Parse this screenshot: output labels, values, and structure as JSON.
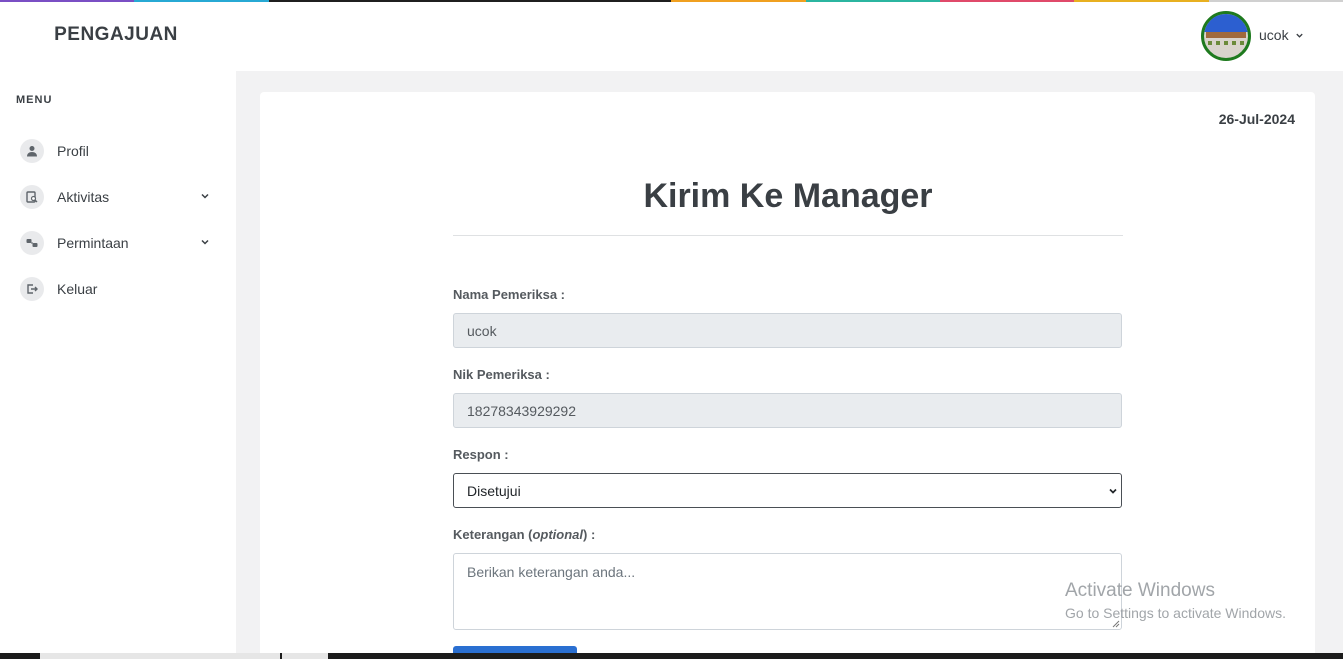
{
  "app": {
    "brand": "PENGAJUAN"
  },
  "sidebar": {
    "menu_label": "MENU",
    "items": [
      {
        "label": "Profil",
        "icon": "user-icon",
        "has_submenu": false
      },
      {
        "label": "Aktivitas",
        "icon": "activity-search-icon",
        "has_submenu": true
      },
      {
        "label": "Permintaan",
        "icon": "request-icon",
        "has_submenu": true
      },
      {
        "label": "Keluar",
        "icon": "logout-icon",
        "has_submenu": false
      }
    ]
  },
  "header": {
    "username": "ucok"
  },
  "main": {
    "date": "26-Jul-2024",
    "title": "Kirim Ke Manager",
    "fields": {
      "nama_label": "Nama Pemeriksa :",
      "nama_value": "ucok",
      "nik_label": "Nik Pemeriksa :",
      "nik_value": "18278343929292",
      "respon_label": "Respon :",
      "respon_value": "Disetujui",
      "keterangan_label_prefix": "Keterangan (",
      "keterangan_label_optional": "optional",
      "keterangan_label_suffix": ") :",
      "keterangan_placeholder": "Berikan keterangan anda..."
    }
  },
  "watermark": {
    "line1": "Activate Windows",
    "line2": "Go to Settings to activate Windows."
  },
  "colors": {
    "accent": "#2a6fd1",
    "avatar_border": "#1e7a1e",
    "top_stripe": [
      "#7a4fc4",
      "#27a9d4",
      "#1f1f1f",
      "#1f1f1f",
      "#1f1f1f",
      "#f0a020",
      "#2bb5a0",
      "#e04a6a",
      "#e8b020",
      "#d0d0d0"
    ]
  }
}
